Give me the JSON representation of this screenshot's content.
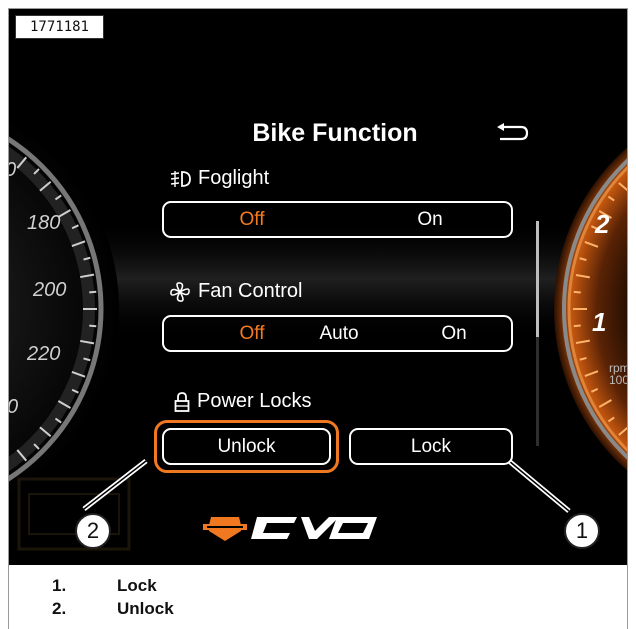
{
  "figure_id": "1771181",
  "screen": {
    "title": "Bike Function",
    "back_icon": "return-arrow-icon",
    "sections": {
      "foglight": {
        "label": "Foglight",
        "icon": "foglight-icon",
        "options": [
          "Off",
          "On"
        ],
        "selected": "Off"
      },
      "fan_control": {
        "label": "Fan Control",
        "icon": "fan-icon",
        "options": [
          "Off",
          "Auto",
          "On"
        ],
        "selected": "Off"
      },
      "power_locks": {
        "label": "Power Locks",
        "icon": "padlock-icon",
        "buttons": [
          "Unlock",
          "Lock"
        ]
      }
    },
    "left_gauge_ticks": [
      "0",
      "180",
      "200",
      "220",
      "0"
    ],
    "right_gauge_ticks": [
      "2",
      "1"
    ],
    "right_gauge_unit": "rpm",
    "right_gauge_unit_value": "100",
    "brand_logo": "CVO",
    "colors": {
      "accent": "#f57a1f",
      "highlight": "#f07820",
      "background": "#000000",
      "text": "#ffffff"
    }
  },
  "callouts": [
    "1",
    "2"
  ],
  "legend": [
    {
      "num": "1.",
      "label": "Lock"
    },
    {
      "num": "2.",
      "label": "Unlock"
    }
  ]
}
